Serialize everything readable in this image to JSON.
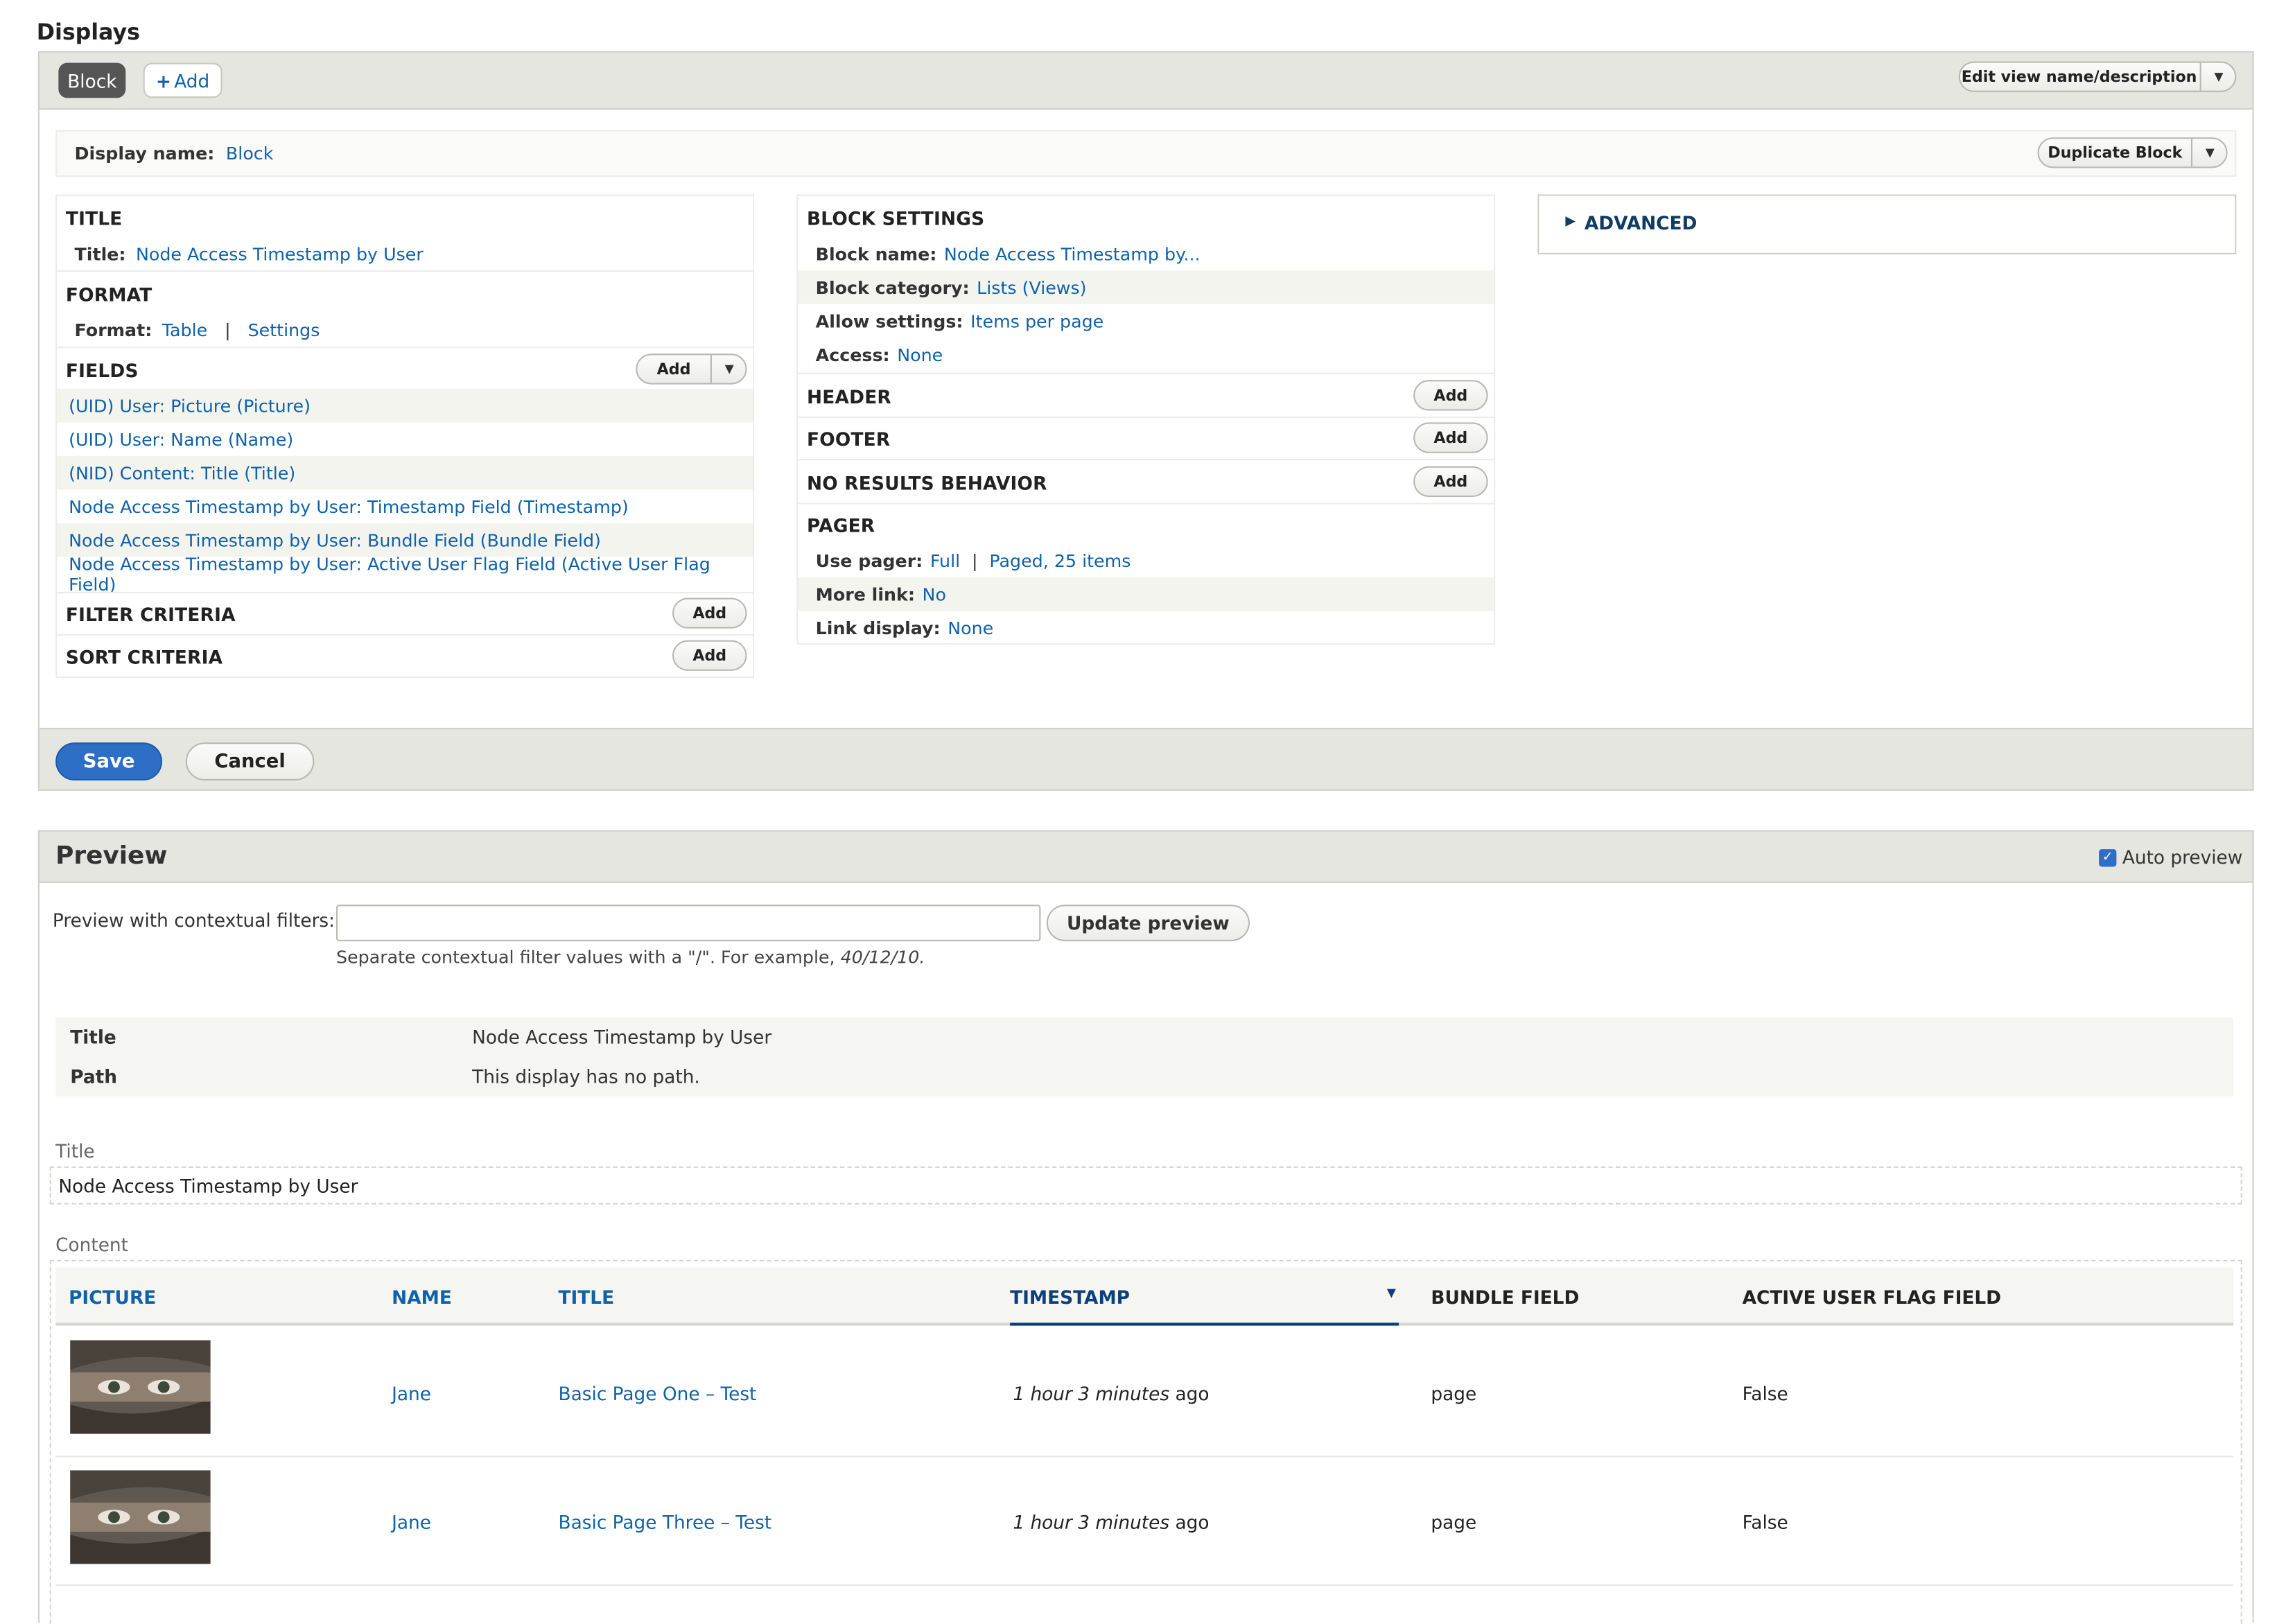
{
  "displays": {
    "heading": "Displays",
    "tab_block": "Block",
    "add_label": "Add",
    "edit_view_label": "Edit view name/description",
    "display_name_label": "Display name:",
    "display_name_value": "Block",
    "duplicate_label": "Duplicate Block"
  },
  "col1": {
    "title_section": "TITLE",
    "title_label": "Title:",
    "title_value": "Node Access Timestamp by User",
    "format_section": "FORMAT",
    "format_label": "Format:",
    "format_value": "Table",
    "format_sep": "|",
    "format_settings": "Settings",
    "fields_section": "FIELDS",
    "fields_add": "Add",
    "fields": [
      "(UID) User: Picture (Picture)",
      "(UID) User: Name (Name)",
      "(NID) Content: Title (Title)",
      "Node Access Timestamp by User: Timestamp Field (Timestamp)",
      "Node Access Timestamp by User: Bundle Field (Bundle Field)",
      "Node Access Timestamp by User: Active User Flag Field (Active User Flag Field)"
    ],
    "filter_section": "FILTER CRITERIA",
    "filter_add": "Add",
    "sort_section": "SORT CRITERIA",
    "sort_add": "Add"
  },
  "col2": {
    "block_settings_section": "BLOCK SETTINGS",
    "block_name_label": "Block name:",
    "block_name_value": "Node Access Timestamp by...",
    "block_category_label": "Block category:",
    "block_category_value": "Lists (Views)",
    "allow_settings_label": "Allow settings:",
    "allow_settings_value": "Items per page",
    "access_label": "Access:",
    "access_value": "None",
    "header_section": "HEADER",
    "header_add": "Add",
    "footer_section": "FOOTER",
    "footer_add": "Add",
    "no_results_section": "NO RESULTS BEHAVIOR",
    "no_results_add": "Add",
    "pager_section": "PAGER",
    "use_pager_label": "Use pager:",
    "use_pager_value": "Full",
    "pager_sep": "|",
    "pager_items": "Paged, 25 items",
    "more_link_label": "More link:",
    "more_link_value": "No",
    "link_display_label": "Link display:",
    "link_display_value": "None"
  },
  "col3": {
    "advanced_label": "ADVANCED",
    "advanced_icon": "triangle-right-icon"
  },
  "actions": {
    "save_label": "Save",
    "cancel_label": "Cancel"
  },
  "preview": {
    "heading": "Preview",
    "auto_preview_label": "Auto preview",
    "auto_preview_checked": true,
    "contextual_label": "Preview with contextual filters:",
    "contextual_value": "",
    "update_label": "Update preview",
    "help_text": "Separate contextual filter values with a \"/\". For example, ",
    "help_example": "40/12/10.",
    "info_rows": [
      {
        "label": "Title",
        "value": "Node Access Timestamp by User"
      },
      {
        "label": "Path",
        "value": "This display has no path."
      }
    ],
    "title_caption": "Title",
    "title_value": "Node Access Timestamp by User",
    "content_caption": "Content",
    "columns": [
      "PICTURE",
      "NAME",
      "TITLE",
      "TIMESTAMP",
      "BUNDLE FIELD",
      "ACTIVE USER FLAG FIELD"
    ],
    "sort_icon": "caret-down-icon",
    "rows": [
      {
        "name": "Jane",
        "title": "Basic Page One – Test",
        "timestamp_em": "1 hour 3 minutes",
        "timestamp_suffix": " ago",
        "bundle": "page",
        "flag": "False"
      },
      {
        "name": "Jane",
        "title": "Basic Page Three – Test",
        "timestamp_em": "1 hour 3 minutes",
        "timestamp_suffix": " ago",
        "bundle": "page",
        "flag": "False"
      }
    ]
  },
  "colors": {
    "link": "#0f62a8",
    "primary_button": "#2d6ec6",
    "tab_active": "#555555",
    "bar_bg": "#e6e6e1"
  }
}
